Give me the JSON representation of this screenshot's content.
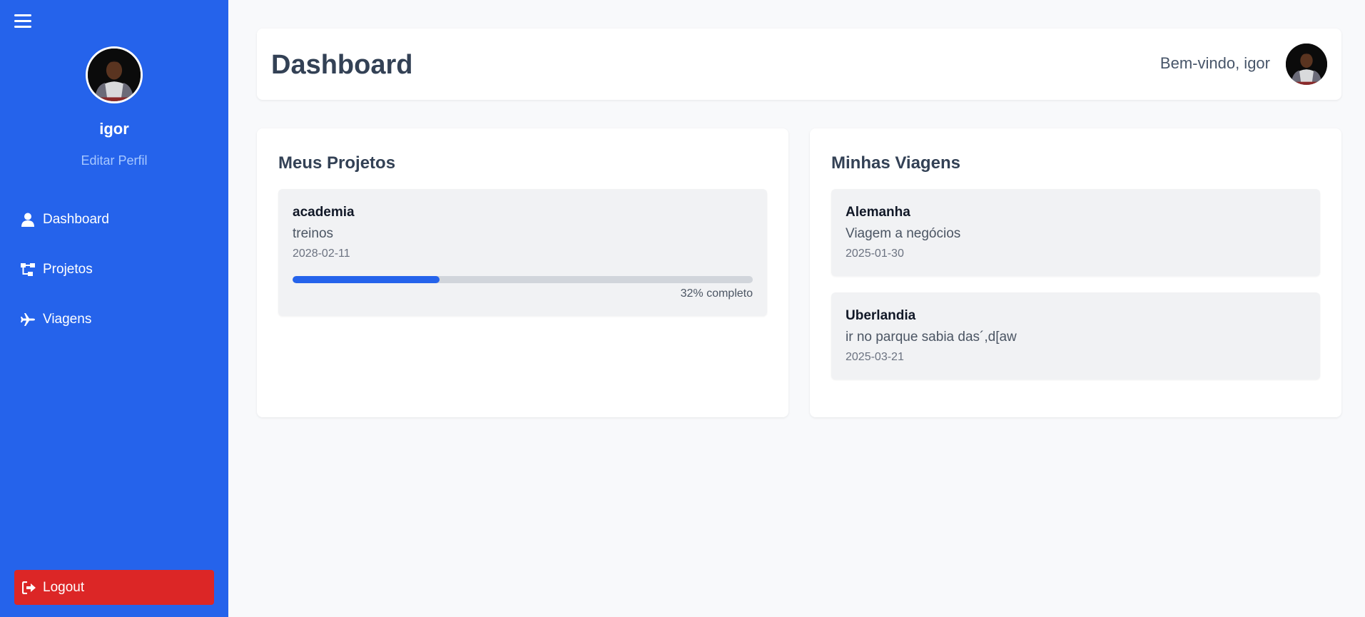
{
  "sidebar": {
    "username": "igor",
    "edit_profile": "Editar Perfil",
    "items": [
      {
        "label": "Dashboard",
        "icon": "user-icon"
      },
      {
        "label": "Projetos",
        "icon": "sitemap-icon"
      },
      {
        "label": "Viagens",
        "icon": "plane-icon"
      }
    ],
    "logout": "Logout"
  },
  "header": {
    "title": "Dashboard",
    "welcome": "Bem-vindo, igor"
  },
  "projects": {
    "title": "Meus Projetos",
    "items": [
      {
        "name": "academia",
        "desc": "treinos",
        "date": "2028-02-11",
        "progress": 32,
        "progress_label": "32% completo"
      }
    ]
  },
  "trips": {
    "title": "Minhas Viagens",
    "items": [
      {
        "name": "Alemanha",
        "desc": "Viagem a negócios",
        "date": "2025-01-30"
      },
      {
        "name": "Uberlandia",
        "desc": "ir no parque sabia das´,d[aw",
        "date": "2025-03-21"
      }
    ]
  },
  "colors": {
    "sidebar": "#2563eb",
    "logout": "#dc2626",
    "progress": "#2563eb"
  }
}
